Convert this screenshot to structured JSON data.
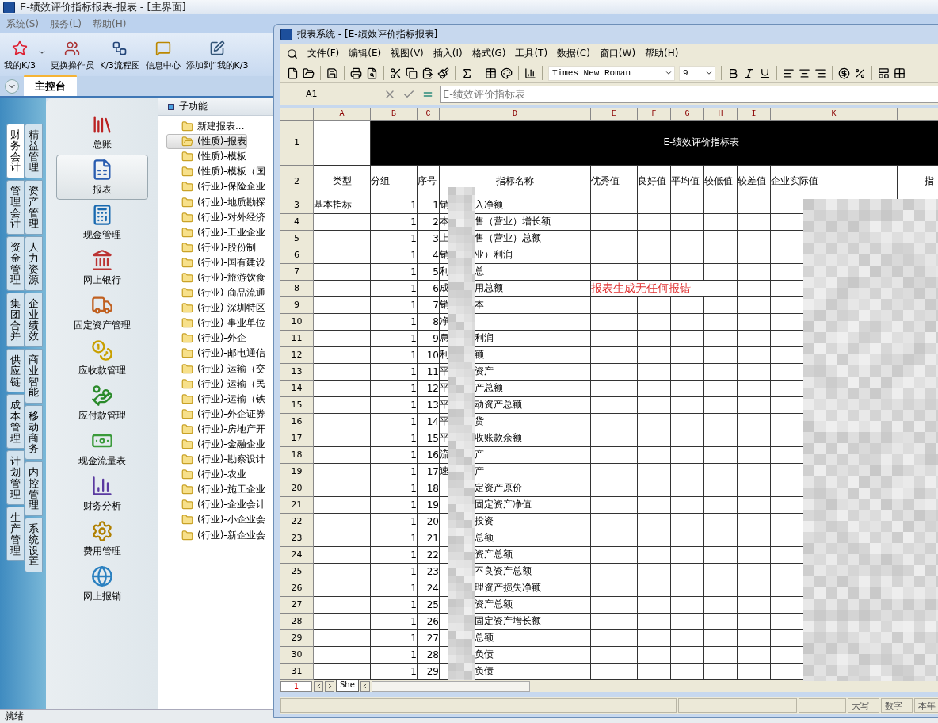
{
  "window": {
    "title": "E-绩效评价指标报表-报表 - [主界面]"
  },
  "menu": [
    "系统(S)",
    "服务(L)",
    "帮助(H)"
  ],
  "toolbar": [
    {
      "label": "我的K/3",
      "kind": "star",
      "dropdown": true
    },
    {
      "label": "更换操作员",
      "kind": "users",
      "dropdown": false
    },
    {
      "label": "K/3流程图",
      "kind": "flow",
      "dropdown": false
    },
    {
      "label": "信息中心",
      "kind": "message",
      "dropdown": false
    },
    {
      "label": "添加到“我的K/3",
      "kind": "edit",
      "dropdown": false
    }
  ],
  "tabs": [
    {
      "label": "主控台",
      "selected": true
    }
  ],
  "module_tabs": {
    "outer": [
      {
        "label": "财务会计",
        "selected": true
      },
      {
        "label": "管理会计",
        "selected": false
      },
      {
        "label": "资金管理",
        "selected": false
      },
      {
        "label": "集团合并",
        "selected": false
      },
      {
        "label": "供应链",
        "selected": false
      },
      {
        "label": "成本管理",
        "selected": false
      },
      {
        "label": "计划管理",
        "selected": false
      },
      {
        "label": "生产管理",
        "selected": false
      }
    ],
    "inner": [
      {
        "label": "精益管理",
        "selected": false
      },
      {
        "label": "资产管理",
        "selected": false
      },
      {
        "label": "人力资源",
        "selected": false
      },
      {
        "label": "企业绩效",
        "selected": false
      },
      {
        "label": "商业智能",
        "selected": false
      },
      {
        "label": "移动商务",
        "selected": false
      },
      {
        "label": "内控管理",
        "selected": false
      },
      {
        "label": "系统设置",
        "selected": false
      }
    ]
  },
  "modules": [
    {
      "label": "总账",
      "kind": "books",
      "selected": false
    },
    {
      "label": "报表",
      "kind": "report",
      "selected": true
    },
    {
      "label": "现金管理",
      "kind": "calculator",
      "selected": false
    },
    {
      "label": "网上银行",
      "kind": "bank",
      "selected": false
    },
    {
      "label": "固定资产管理",
      "kind": "truck",
      "selected": false
    },
    {
      "label": "应收款管理",
      "kind": "coins",
      "selected": false
    },
    {
      "label": "应付款管理",
      "kind": "handcoins",
      "selected": false
    },
    {
      "label": "现金流量表",
      "kind": "banknote",
      "selected": false
    },
    {
      "label": "财务分析",
      "kind": "chart",
      "selected": false
    },
    {
      "label": "费用管理",
      "kind": "gear",
      "selected": false
    },
    {
      "label": "网上报销",
      "kind": "globe",
      "selected": false
    }
  ],
  "subfunctions": {
    "title": "子功能",
    "items": [
      {
        "label": "新建报表...",
        "selected": false
      },
      {
        "label": "(性质)-报表",
        "selected": true
      },
      {
        "label": "(性质)-模板",
        "selected": false
      },
      {
        "label": "(性质)-模板（国",
        "selected": false
      },
      {
        "label": "(行业)-保险企业",
        "selected": false
      },
      {
        "label": "(行业)-地质勘探",
        "selected": false
      },
      {
        "label": "(行业)-对外经济",
        "selected": false
      },
      {
        "label": "(行业)-工业企业",
        "selected": false
      },
      {
        "label": "(行业)-股份制",
        "selected": false
      },
      {
        "label": "(行业)-国有建设",
        "selected": false
      },
      {
        "label": "(行业)-旅游饮食",
        "selected": false
      },
      {
        "label": "(行业)-商品流通",
        "selected": false
      },
      {
        "label": "(行业)-深圳特区",
        "selected": false
      },
      {
        "label": "(行业)-事业单位",
        "selected": false
      },
      {
        "label": "(行业)-外企",
        "selected": false
      },
      {
        "label": "(行业)-邮电通信",
        "selected": false
      },
      {
        "label": "(行业)-运输（交",
        "selected": false
      },
      {
        "label": "(行业)-运输（民",
        "selected": false
      },
      {
        "label": "(行业)-运输（铁",
        "selected": false
      },
      {
        "label": "(行业)-外企证券",
        "selected": false
      },
      {
        "label": "(行业)-房地产开",
        "selected": false
      },
      {
        "label": "(行业)-金融企业",
        "selected": false
      },
      {
        "label": "(行业)-勘察设计",
        "selected": false
      },
      {
        "label": "(行业)-农业",
        "selected": false
      },
      {
        "label": "(行业)-施工企业",
        "selected": false
      },
      {
        "label": "(行业)-企业会计",
        "selected": false
      },
      {
        "label": "(行业)-小企业会",
        "selected": false
      },
      {
        "label": "(行业)-新企业会",
        "selected": false
      }
    ]
  },
  "status_bar": "就绪",
  "report_window": {
    "title": "报表系统 - [E-绩效评价指标报表]",
    "menu": [
      "文件(F)",
      "编辑(E)",
      "视图(V)",
      "插入(I)",
      "格式(G)",
      "工具(T)",
      "数据(C)",
      "窗口(W)",
      "帮助(H)"
    ],
    "font": "Times New Roman",
    "font_size": "9",
    "cell_ref": "A1",
    "formula": "E-绩效评价指标表",
    "columns": [
      "A",
      "B",
      "C",
      "D",
      "E",
      "F",
      "G",
      "H",
      "I",
      "K"
    ],
    "title_row": {
      "number": "1",
      "title": "E-绩效评价指标表"
    },
    "header_row": {
      "number": "2",
      "cells": [
        "类型",
        "分组",
        "序号",
        "指标名称",
        "优秀值",
        "良好值",
        "平均值",
        "较低值",
        "较差值",
        "企业实际值",
        "指"
      ]
    },
    "rows": [
      {
        "number": "3",
        "type": "基本指标",
        "group": "1",
        "seq": "1",
        "name_left": "销",
        "name_right": "入净额"
      },
      {
        "number": "4",
        "group": "1",
        "seq": "2",
        "name_left": "本",
        "name_right": "售（营业）增长额"
      },
      {
        "number": "5",
        "group": "1",
        "seq": "3",
        "name_left": "上",
        "name_right": "售（营业）总额"
      },
      {
        "number": "6",
        "group": "1",
        "seq": "4",
        "name_left": "销",
        "name_right": "业）利润"
      },
      {
        "number": "7",
        "group": "1",
        "seq": "5",
        "name_left": "利",
        "name_right": "总"
      },
      {
        "number": "8",
        "group": "1",
        "seq": "6",
        "name_left": "成",
        "name_right": "用总额",
        "note": "报表生成无任何报错"
      },
      {
        "number": "9",
        "group": "1",
        "seq": "7",
        "name_left": "销",
        "name_right": "本"
      },
      {
        "number": "10",
        "group": "1",
        "seq": "8",
        "name_left": "净"
      },
      {
        "number": "11",
        "group": "1",
        "seq": "9",
        "name_left": "息",
        "name_right": "利润"
      },
      {
        "number": "12",
        "group": "1",
        "seq": "10",
        "name_left": "利",
        "name_right": "额"
      },
      {
        "number": "13",
        "group": "1",
        "seq": "11",
        "name_left": "平",
        "name_right": "资产"
      },
      {
        "number": "14",
        "group": "1",
        "seq": "12",
        "name_left": "平",
        "name_right": "产总额"
      },
      {
        "number": "15",
        "group": "1",
        "seq": "13",
        "name_left": "平",
        "name_right": "动资产总额"
      },
      {
        "number": "16",
        "group": "1",
        "seq": "14",
        "name_left": "平",
        "name_right": "货"
      },
      {
        "number": "17",
        "group": "1",
        "seq": "15",
        "name_left": "平",
        "name_right": "收账款余额"
      },
      {
        "number": "18",
        "group": "1",
        "seq": "16",
        "name_left": "流",
        "name_right": "产"
      },
      {
        "number": "19",
        "group": "1",
        "seq": "17",
        "name_left": "速",
        "name_right": "产"
      },
      {
        "number": "20",
        "group": "1",
        "seq": "18",
        "name_right": "定资产原价"
      },
      {
        "number": "21",
        "group": "1",
        "seq": "19",
        "name_right": "固定资产净值"
      },
      {
        "number": "22",
        "group": "1",
        "seq": "20",
        "name_right": "投资"
      },
      {
        "number": "23",
        "group": "1",
        "seq": "21",
        "name_right": "总额"
      },
      {
        "number": "24",
        "group": "1",
        "seq": "22",
        "name_right": "资产总额"
      },
      {
        "number": "25",
        "group": "1",
        "seq": "23",
        "name_right": "不良资产总额"
      },
      {
        "number": "26",
        "group": "1",
        "seq": "24",
        "name_right": "理资产损失净额"
      },
      {
        "number": "27",
        "group": "1",
        "seq": "25",
        "name_right": "资产总额"
      },
      {
        "number": "28",
        "group": "1",
        "seq": "26",
        "name_right": "固定资产增长额"
      },
      {
        "number": "29",
        "group": "1",
        "seq": "27",
        "name_right": "总额"
      },
      {
        "number": "30",
        "group": "1",
        "seq": "28",
        "name_right": "负债"
      },
      {
        "number": "31",
        "group": "1",
        "seq": "29",
        "name_right": "负债"
      }
    ],
    "sheet_index": "1",
    "sheet_tab": "She",
    "status": [
      "大写",
      "数字",
      "本年"
    ]
  }
}
